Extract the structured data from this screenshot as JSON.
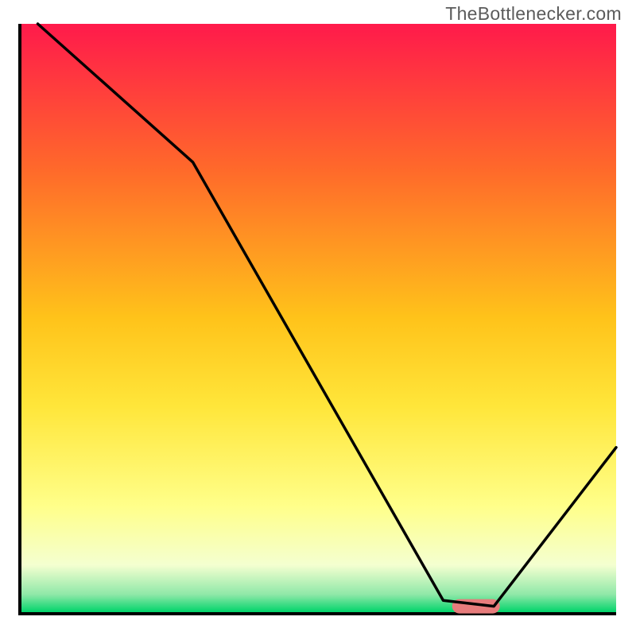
{
  "watermark": "TheBottlenecker.com",
  "chart_data": {
    "type": "line",
    "title": "",
    "xlabel": "",
    "ylabel": "",
    "xlim": [
      0,
      100
    ],
    "ylim": [
      0,
      100
    ],
    "series": [
      {
        "name": "curve",
        "x": [
          3.0,
          29.0,
          71.0,
          79.5,
          100.0
        ],
        "values": [
          100.0,
          76.5,
          2.0,
          1.0,
          28.0
        ]
      }
    ],
    "background_gradient_top_to_bottom": [
      "#ff1a4b",
      "#ff6a2a",
      "#ffc31a",
      "#ffe63a",
      "#ffff8a",
      "#f4ffd0",
      "#8fe8a8",
      "#00d46a"
    ],
    "marker": {
      "x_start": 72.5,
      "x_end": 80.5,
      "y": 1.0,
      "color": "#e77c7c"
    },
    "axis_color": "#000000"
  }
}
